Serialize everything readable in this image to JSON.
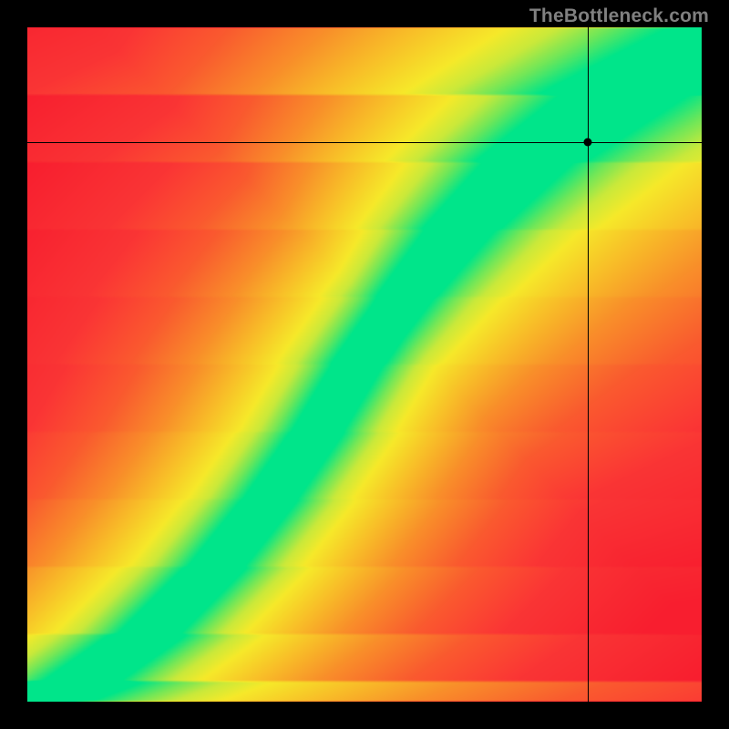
{
  "watermark": "TheBottleneck.com",
  "chart_data": {
    "type": "heatmap",
    "title": "",
    "xlabel": "",
    "ylabel": "",
    "xlim": [
      0,
      1
    ],
    "ylim": [
      0,
      1
    ],
    "grid": false,
    "legend": null,
    "crosshair": {
      "x": 0.831,
      "y": 0.83
    },
    "crosshair_dot_color": "#000000",
    "color_stops": [
      {
        "d": 0.0,
        "color": "#00E58A"
      },
      {
        "d": 0.07,
        "color": "#6DE75A"
      },
      {
        "d": 0.14,
        "color": "#C9E93B"
      },
      {
        "d": 0.22,
        "color": "#F6E92A"
      },
      {
        "d": 0.35,
        "color": "#F8C528"
      },
      {
        "d": 0.55,
        "color": "#F98F2A"
      },
      {
        "d": 0.8,
        "color": "#FA5A2F"
      },
      {
        "d": 1.1,
        "color": "#FA3535"
      },
      {
        "d": 1.6,
        "color": "#F81E2F"
      }
    ],
    "ridge_control_points": [
      {
        "x": 0.0,
        "y": 0.0
      },
      {
        "x": 0.08,
        "y": 0.03
      },
      {
        "x": 0.18,
        "y": 0.1
      },
      {
        "x": 0.28,
        "y": 0.2
      },
      {
        "x": 0.36,
        "y": 0.3
      },
      {
        "x": 0.43,
        "y": 0.4
      },
      {
        "x": 0.49,
        "y": 0.5
      },
      {
        "x": 0.56,
        "y": 0.6
      },
      {
        "x": 0.64,
        "y": 0.7
      },
      {
        "x": 0.74,
        "y": 0.8
      },
      {
        "x": 0.88,
        "y": 0.9
      },
      {
        "x": 1.0,
        "y": 0.955
      }
    ],
    "band_half_width": 0.055,
    "resolution": 210
  }
}
